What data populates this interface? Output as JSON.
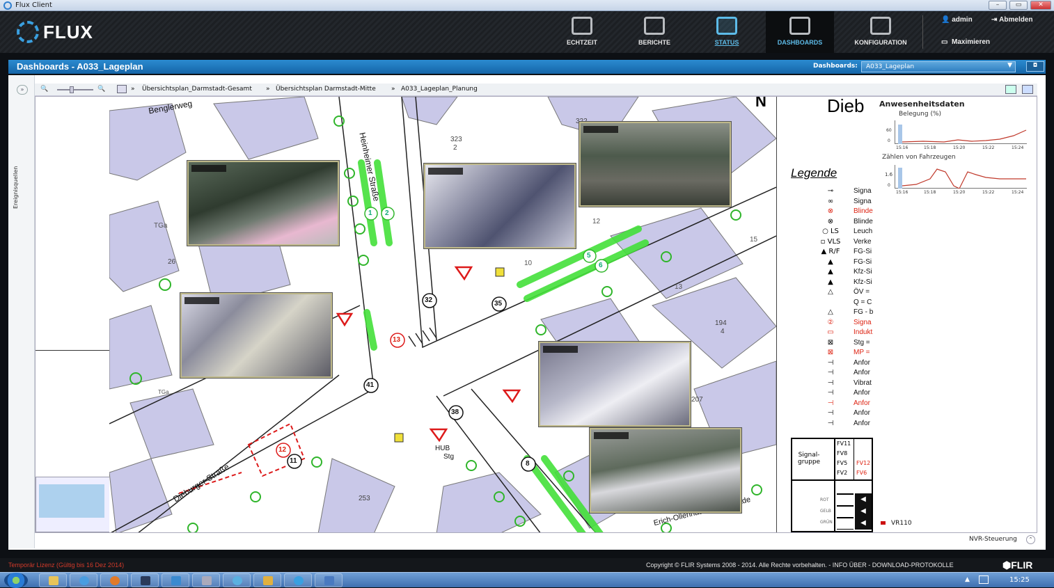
{
  "window": {
    "title": "Flux Client",
    "controls": [
      "–",
      "▭",
      "✕"
    ]
  },
  "brand": {
    "logo_text": "FLUX",
    "accent": "#3aa0e0"
  },
  "nav": [
    {
      "label": "ECHTZEIT",
      "icon": "clock-icon"
    },
    {
      "label": "BERICHTE",
      "icon": "report-icon"
    },
    {
      "label": "STATUS",
      "icon": "camera-icon"
    },
    {
      "label": "DASHBOARDS",
      "icon": "dashboard-icon"
    },
    {
      "label": "KONFIGURATION",
      "icon": "settings-arrows-icon"
    }
  ],
  "user": {
    "name": "admin",
    "logout": "Abmelden",
    "maximize": "Maximieren"
  },
  "dashboard_bar": {
    "title": "Dashboards - A033_Lageplan",
    "select_label": "Dashboards:",
    "select_value": "A033_Lageplan"
  },
  "sidebar": {
    "label": "Ereignisquellen",
    "toggle": "»"
  },
  "breadcrumb": [
    "Übersichtsplan_Darmstadt-Gesamt",
    "Übersichtsplan Darmstadt-Mitte",
    "A033_Lageplan_Planung"
  ],
  "map": {
    "streets": [
      "Benglerweg",
      "Heinheimer Straße",
      "Dieburger Straße",
      "Erich-Ollenhauer-Promenade"
    ],
    "labels": [
      "TGa",
      "TGa",
      "26",
      "322",
      "323",
      "2",
      "194",
      "4",
      "207",
      "253",
      "15",
      "12",
      "13",
      "10"
    ],
    "markers": [
      "32",
      "35",
      "13",
      "41",
      "38",
      "12",
      "11",
      "8",
      "1",
      "2",
      "5",
      "6"
    ],
    "other": [
      "HUB",
      "Stg",
      "N"
    ]
  },
  "legend": {
    "heading_partial": "Dieb",
    "title": "Legende",
    "rows": [
      {
        "sym": "⊸",
        "text": "Signa",
        "red": false
      },
      {
        "sym": "∞",
        "text": "Signa",
        "red": false
      },
      {
        "sym": "⊗",
        "text": "Blinde",
        "red": true
      },
      {
        "sym": "⊗",
        "text": "Blinde",
        "red": false
      },
      {
        "sym": "○ LS",
        "text": "Leuch",
        "red": false
      },
      {
        "sym": "▫ VLS",
        "text": "Verke",
        "red": false
      },
      {
        "sym": "▲ R/F",
        "text": "FG-Si",
        "red": false
      },
      {
        "sym": "▲",
        "text": "FG-Si",
        "red": false
      },
      {
        "sym": "▲",
        "text": "Kfz-Si",
        "red": false
      },
      {
        "sym": "▲",
        "text": "Kfz-Si",
        "red": false
      },
      {
        "sym": "△",
        "text": "ÖV =",
        "red": false
      },
      {
        "sym": "",
        "text": "Q = C",
        "red": false
      },
      {
        "sym": "△",
        "text": "FG - b",
        "red": false
      },
      {
        "sym": "②",
        "text": "Signa",
        "red": true
      },
      {
        "sym": "▭",
        "text": "Indukt",
        "red": true
      },
      {
        "sym": "⊠",
        "text": "Stg =",
        "red": false
      },
      {
        "sym": "⊠",
        "text": "MP =",
        "red": true
      },
      {
        "sym": "⊣",
        "text": "Anfor",
        "red": false
      },
      {
        "sym": "⊣",
        "text": "Anfor",
        "red": false
      },
      {
        "sym": "⊣",
        "text": "Vibrat",
        "red": false
      },
      {
        "sym": "⊣",
        "text": "Anfor",
        "red": false
      },
      {
        "sym": "⊣",
        "text": "Anfor",
        "red": true
      },
      {
        "sym": "⊣",
        "text": "Anfor",
        "red": false
      },
      {
        "sym": "⊣",
        "text": "Anfor",
        "red": false
      }
    ],
    "signal_table": {
      "header": "Signal-\ngruppe",
      "groups": [
        "FV11",
        "FV8",
        "FV5",
        "FV2"
      ],
      "red_extra": [
        "FV12",
        "FV6"
      ],
      "lights": [
        "ROT",
        "GELB",
        "GRÜN"
      ]
    }
  },
  "presence": {
    "title": "Anwesenheitsdaten",
    "occupancy_label": "Belegung (%)",
    "occupancy_ymax": "60",
    "occupancy_y0": "0",
    "count_label": "Zählen von Fahrzeugen",
    "count_ymax": "1.6",
    "count_y0": "0",
    "times": [
      "15:16",
      "15:18",
      "15:20",
      "15:22",
      "15:24"
    ],
    "series_label": "VR110",
    "series_color": "#cc1111"
  },
  "nvr": {
    "label": "NVR-Steuerung",
    "toggle": "⌃"
  },
  "footer": {
    "license": "Temporär Lizenz (Gültig bis 16 Dez 2014)",
    "copyright": "Copyright © FLIR Systems 2008 - 2014. Alle Rechte vorbehalten.  -  INFO ÜBER  -  DOWNLOAD-PROTOKOLLE",
    "brand": "⬢FLIR"
  },
  "taskbar": {
    "clock": "15:25"
  }
}
